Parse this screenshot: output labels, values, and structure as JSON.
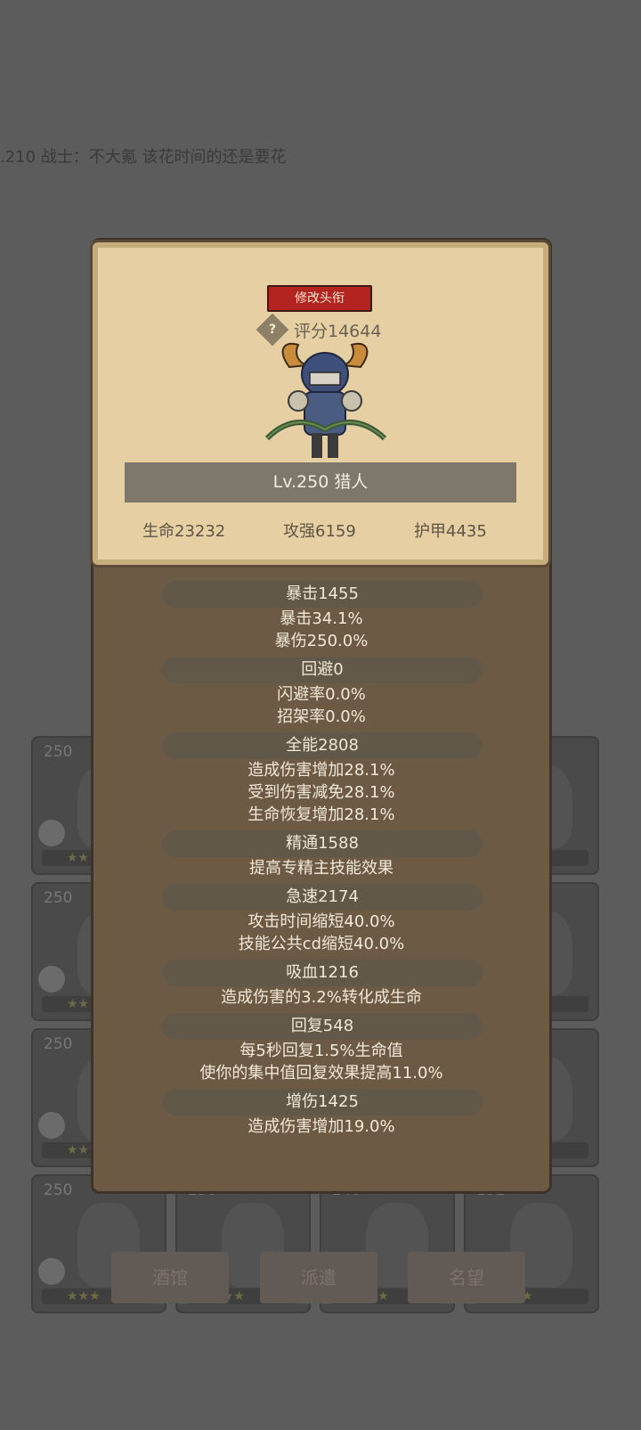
{
  "marquee": ".210 战士：不大氪  该花时间的还是要花",
  "modal": {
    "title_button": "修改头衔",
    "score_prefix": "评分",
    "score": "评分14644",
    "level_class": "Lv.250 猎人",
    "base_stats": [
      "生命23232",
      "攻强6159",
      "护甲4435"
    ]
  },
  "stats": [
    {
      "head": "暴击1455",
      "lines": [
        "暴击34.1%",
        "暴伤250.0%"
      ]
    },
    {
      "head": "回避0",
      "lines": [
        "闪避率0.0%",
        "招架率0.0%"
      ]
    },
    {
      "head": "全能2808",
      "lines": [
        "造成伤害增加28.1%",
        "受到伤害减免28.1%",
        "生命恢复增加28.1%"
      ]
    },
    {
      "head": "精通1588",
      "lines": [
        "提高专精主技能效果"
      ]
    },
    {
      "head": "急速2174",
      "lines": [
        "攻击时间缩短40.0%",
        "技能公共cd缩短40.0%"
      ]
    },
    {
      "head": "吸血1216",
      "lines": [
        "造成伤害的3.2%转化成生命"
      ]
    },
    {
      "head": "回复548",
      "lines": [
        "每5秒回复1.5%生命值",
        "使你的集中值回复效果提高11.0%"
      ]
    },
    {
      "head": "增伤1425",
      "lines": [
        "造成伤害增加19.0%"
      ]
    }
  ],
  "background_cards": [
    {
      "level": "250"
    },
    {
      "level": ""
    },
    {
      "level": ""
    },
    {
      "level": ""
    },
    {
      "level": "250"
    },
    {
      "level": ""
    },
    {
      "level": ""
    },
    {
      "level": ""
    },
    {
      "level": "250"
    },
    {
      "level": ""
    },
    {
      "level": ""
    },
    {
      "level": ""
    },
    {
      "level": "250"
    },
    {
      "level": "250"
    },
    {
      "level": "240"
    },
    {
      "level": "192"
    }
  ],
  "bottom_buttons": [
    "酒馆",
    "派遣",
    "名望"
  ],
  "colors": {
    "modal_bg": "#6d5a44",
    "panel": "#e6cfa2",
    "title_btn": "#b3231f"
  }
}
